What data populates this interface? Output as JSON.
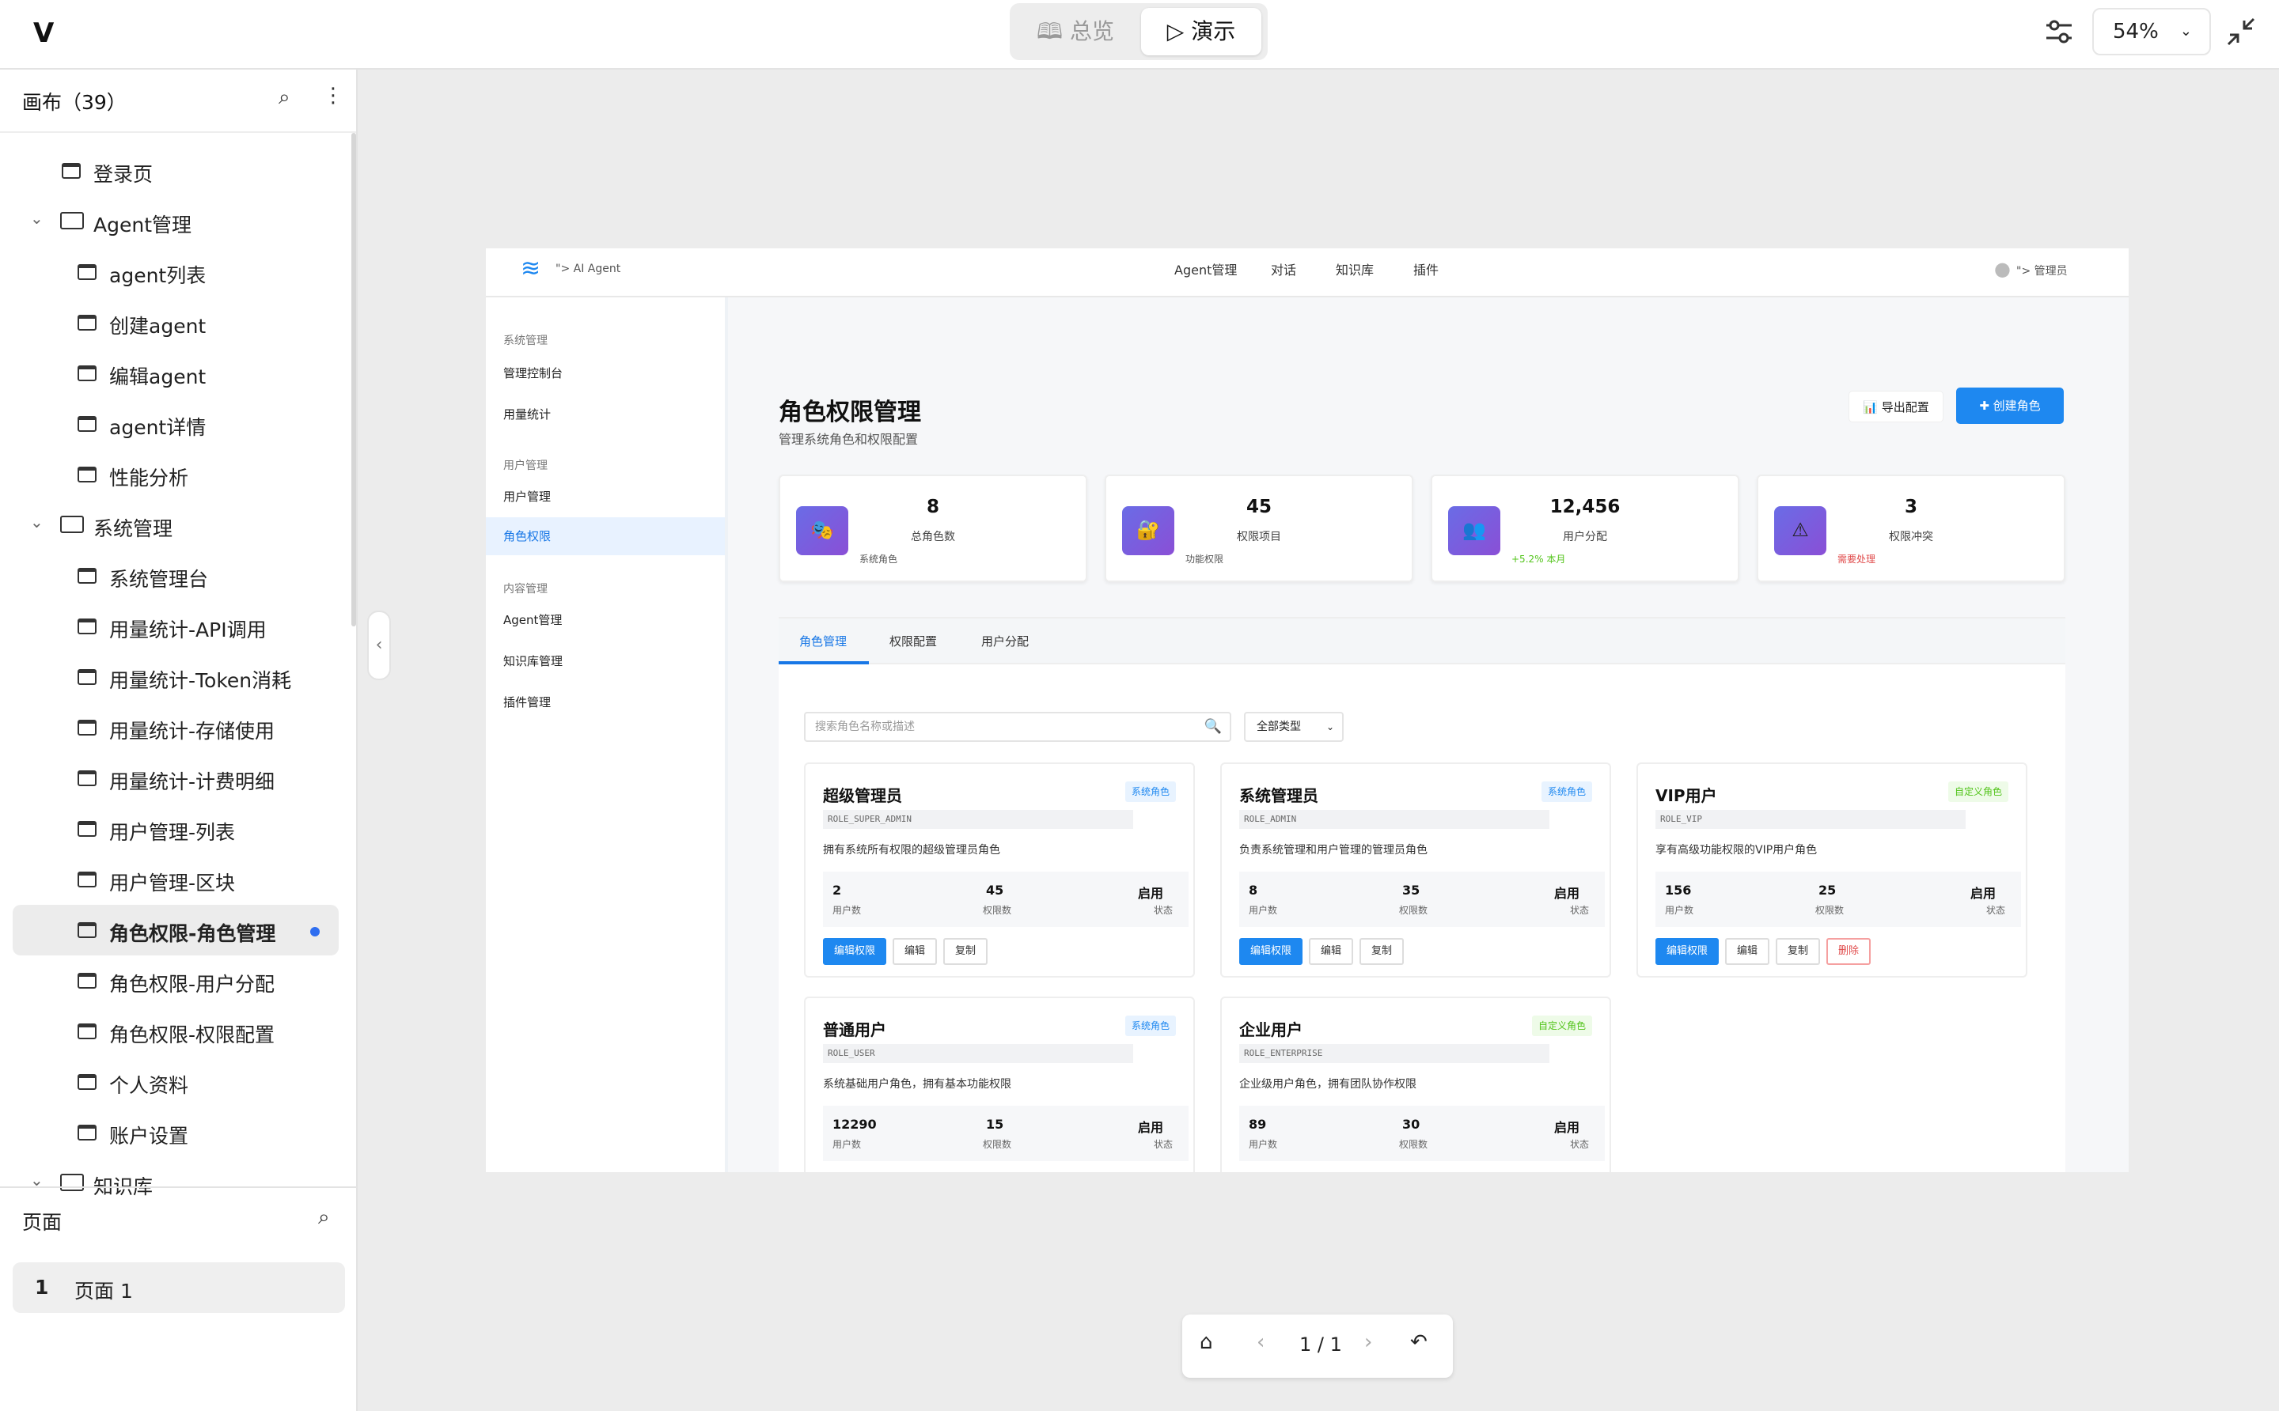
{
  "topbar": {
    "overview": "总览",
    "present": "演示",
    "zoom": "54%"
  },
  "sidebar": {
    "title": "画布（39）",
    "items": [
      {
        "label": "登录页",
        "kind": "page",
        "lvl": 0
      },
      {
        "label": "Agent管理",
        "kind": "folder",
        "lvl": 0
      },
      {
        "label": "agent列表",
        "kind": "page",
        "lvl": 1
      },
      {
        "label": "创建agent",
        "kind": "page",
        "lvl": 1
      },
      {
        "label": "编辑agent",
        "kind": "page",
        "lvl": 1
      },
      {
        "label": "agent详情",
        "kind": "page",
        "lvl": 1
      },
      {
        "label": "性能分析",
        "kind": "page",
        "lvl": 1
      },
      {
        "label": "系统管理",
        "kind": "folder",
        "lvl": 0
      },
      {
        "label": "系统管理台",
        "kind": "page",
        "lvl": 1
      },
      {
        "label": "用量统计-API调用",
        "kind": "page",
        "lvl": 1
      },
      {
        "label": "用量统计-Token消耗",
        "kind": "page",
        "lvl": 1
      },
      {
        "label": "用量统计-存储使用",
        "kind": "page",
        "lvl": 1
      },
      {
        "label": "用量统计-计费明细",
        "kind": "page",
        "lvl": 1
      },
      {
        "label": "用户管理-列表",
        "kind": "page",
        "lvl": 1
      },
      {
        "label": "用户管理-区块",
        "kind": "page",
        "lvl": 1
      },
      {
        "label": "角色权限-角色管理",
        "kind": "page",
        "lvl": 1,
        "active": true
      },
      {
        "label": "角色权限-用户分配",
        "kind": "page",
        "lvl": 1
      },
      {
        "label": "角色权限-权限配置",
        "kind": "page",
        "lvl": 1
      },
      {
        "label": "个人资料",
        "kind": "page",
        "lvl": 1
      },
      {
        "label": "账户设置",
        "kind": "page",
        "lvl": 1
      },
      {
        "label": "知识库",
        "kind": "folder",
        "lvl": 0
      }
    ],
    "pages_title": "页面",
    "page_num": "1",
    "page_name": "页面 1"
  },
  "app": {
    "brand": "\"> AI Agent",
    "user": "\"> 管理员",
    "nav": [
      "Agent管理",
      "对话",
      "知识库",
      "插件"
    ],
    "menu": [
      {
        "type": "group",
        "label": "系统管理"
      },
      {
        "type": "item",
        "label": "管理控制台"
      },
      {
        "type": "item",
        "label": "用量统计"
      },
      {
        "type": "group",
        "label": "用户管理"
      },
      {
        "type": "item",
        "label": "用户管理"
      },
      {
        "type": "item",
        "label": "角色权限",
        "active": true
      },
      {
        "type": "group",
        "label": "内容管理"
      },
      {
        "type": "item",
        "label": "Agent管理"
      },
      {
        "type": "item",
        "label": "知识库管理"
      },
      {
        "type": "item",
        "label": "插件管理"
      }
    ],
    "title": "角色权限管理",
    "subtitle": "管理系统角色和权限配置",
    "export_label": "导出配置",
    "create_label": "创建角色",
    "stats": [
      {
        "value": "8",
        "label": "总角色数",
        "sub": "系统角色",
        "sub_color": "#555555",
        "emoji": "🎭"
      },
      {
        "value": "45",
        "label": "权限项目",
        "sub": "功能权限",
        "sub_color": "#555555",
        "emoji": "🔐"
      },
      {
        "value": "12,456",
        "label": "用户分配",
        "sub": "+5.2% 本月",
        "sub_color": "#52c41a",
        "emoji": "👥"
      },
      {
        "value": "3",
        "label": "权限冲突",
        "sub": "需要处理",
        "sub_color": "#e04a4a",
        "emoji": "⚠"
      }
    ],
    "tabs": [
      "角色管理",
      "权限配置",
      "用户分配"
    ],
    "search_placeholder": "搜索角色名称或描述",
    "filter": "全部类型",
    "labels": {
      "users": "用户数",
      "perms": "权限数",
      "status": "状态",
      "edit_perm": "编辑权限",
      "edit": "编辑",
      "copy": "复制",
      "delete": "删除"
    },
    "roles": [
      {
        "name": "超级管理员",
        "tag": "系统角色",
        "tag_type": "sys",
        "code": "ROLE_SUPER_ADMIN",
        "desc": "拥有系统所有权限的超级管理员角色",
        "users": "2",
        "perms": "45",
        "status": "启用",
        "deletable": false
      },
      {
        "name": "系统管理员",
        "tag": "系统角色",
        "tag_type": "sys",
        "code": "ROLE_ADMIN",
        "desc": "负责系统管理和用户管理的管理员角色",
        "users": "8",
        "perms": "35",
        "status": "启用",
        "deletable": false
      },
      {
        "name": "VIP用户",
        "tag": "自定义角色",
        "tag_type": "cus",
        "code": "ROLE_VIP",
        "desc": "享有高级功能权限的VIP用户角色",
        "users": "156",
        "perms": "25",
        "status": "启用",
        "deletable": true
      },
      {
        "name": "普通用户",
        "tag": "系统角色",
        "tag_type": "sys",
        "code": "ROLE_USER",
        "desc": "系统基础用户角色，拥有基本功能权限",
        "users": "12290",
        "perms": "15",
        "status": "启用",
        "deletable": false
      },
      {
        "name": "企业用户",
        "tag": "自定义角色",
        "tag_type": "cus",
        "code": "ROLE_ENTERPRISE",
        "desc": "企业级用户角色，拥有团队协作权限",
        "users": "89",
        "perms": "30",
        "status": "启用",
        "deletable": true
      }
    ]
  },
  "pager": {
    "text": "1 / 1"
  }
}
